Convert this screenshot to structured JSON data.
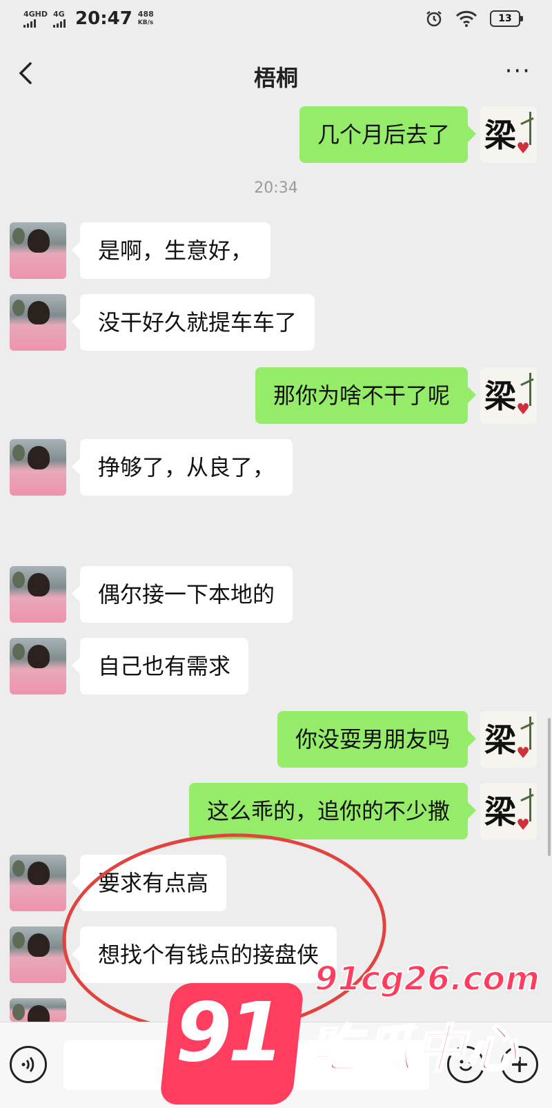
{
  "status_bar": {
    "net1": "4GHD",
    "net2": "4G",
    "time": "20:47",
    "speed_value": "488",
    "speed_unit": "KB/s",
    "battery": "13"
  },
  "header": {
    "title": "梧桐"
  },
  "messages": [
    {
      "side": "out",
      "text": "几个月后去了"
    },
    {
      "type": "timestamp",
      "text": "20:34"
    },
    {
      "side": "in",
      "text": "是啊，生意好，"
    },
    {
      "side": "in",
      "text": "没干好久就提车车了"
    },
    {
      "side": "out",
      "text": "那你为啥不干了呢"
    },
    {
      "side": "in",
      "text": "挣够了，从良了，"
    },
    {
      "side": "in",
      "text": "偶尔接一下本地的"
    },
    {
      "side": "in",
      "text": "自己也有需求"
    },
    {
      "side": "out",
      "text": "你没耍男朋友吗"
    },
    {
      "side": "out",
      "text": "这么乖的，追你的不少撒"
    },
    {
      "side": "in",
      "text": "要求有点高"
    },
    {
      "side": "in",
      "text": "想找个有钱点的接盘侠"
    }
  ],
  "contact_avatar_char": "梁",
  "watermark": {
    "number": "91",
    "url": "91cg26.com",
    "name": "吃瓜中心"
  },
  "icons": {
    "back": "back-arrow-icon",
    "more": "more-dots-icon",
    "voice": "voice-icon",
    "emoji": "emoji-icon",
    "plus": "plus-icon"
  }
}
